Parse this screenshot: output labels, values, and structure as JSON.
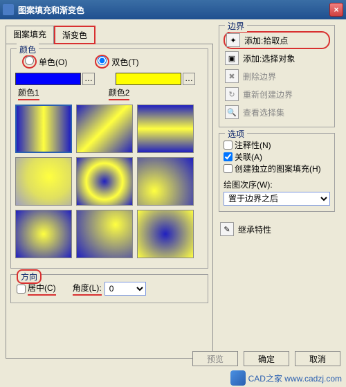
{
  "window": {
    "title": "图案填充和渐变色"
  },
  "tabs": {
    "pattern": "图案填充",
    "gradient": "渐变色"
  },
  "color": {
    "group": "颜色",
    "single": "单色(O)",
    "double": "双色(T)",
    "label1": "颜色1",
    "label2": "颜色2"
  },
  "direction": {
    "group": "方向",
    "center": "居中(C)",
    "angle_label": "角度(L):",
    "angle_value": "0"
  },
  "boundary": {
    "group": "边界",
    "add_pick": "添加:拾取点",
    "add_select": "添加:选择对象",
    "delete": "删除边界",
    "recreate": "重新创建边界",
    "view": "查看选择集"
  },
  "options": {
    "group": "选项",
    "annotative": "注释性(N)",
    "associative": "关联(A)",
    "independent": "创建独立的图案填充(H)",
    "draw_order_label": "绘图次序(W):",
    "draw_order_value": "置于边界之后"
  },
  "inherit": "继承特性",
  "footer": {
    "preview": "预览",
    "ok": "确定",
    "cancel": "取消"
  },
  "watermark": "CAD之家 www.cadzj.com"
}
